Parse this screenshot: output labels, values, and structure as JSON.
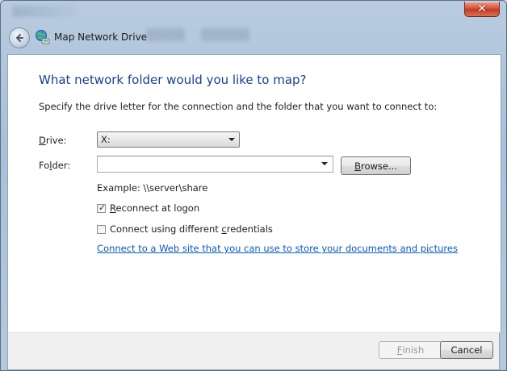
{
  "window": {
    "title": "Map Network Drive",
    "close_glyph": "✕",
    "accent_color": "#1b3f8b",
    "link_color": "#0a5ab4"
  },
  "nav": {
    "back_icon": "back-arrow-icon",
    "app_icon": "network-drive-icon"
  },
  "main": {
    "heading": "What network folder would you like to map?",
    "instruction": "Specify the drive letter for the connection and the folder that you want to connect to:",
    "drive_label_mnemonic": "D",
    "drive_label_rest": "rive:",
    "drive_value": "X:",
    "folder_label_prefix": "Fo",
    "folder_label_mnemonic": "l",
    "folder_label_rest": "der:",
    "folder_value": "",
    "browse_label_mnemonic": "B",
    "browse_label_rest": "rowse...",
    "example": "Example: \\\\server\\share",
    "reconnect_label_mnemonic": "R",
    "reconnect_label_rest": "econnect at logon",
    "reconnect_checked": true,
    "credentials_label_prefix": "Connect using different ",
    "credentials_label_mnemonic": "c",
    "credentials_label_rest": "redentials",
    "credentials_checked": false,
    "web_link": "Connect to a Web site that you can use to store your documents and pictures",
    "web_link_suffix": "."
  },
  "footer": {
    "finish_label_mnemonic": "F",
    "finish_label_rest": "inish",
    "finish_enabled": false,
    "cancel_label": "Cancel"
  }
}
